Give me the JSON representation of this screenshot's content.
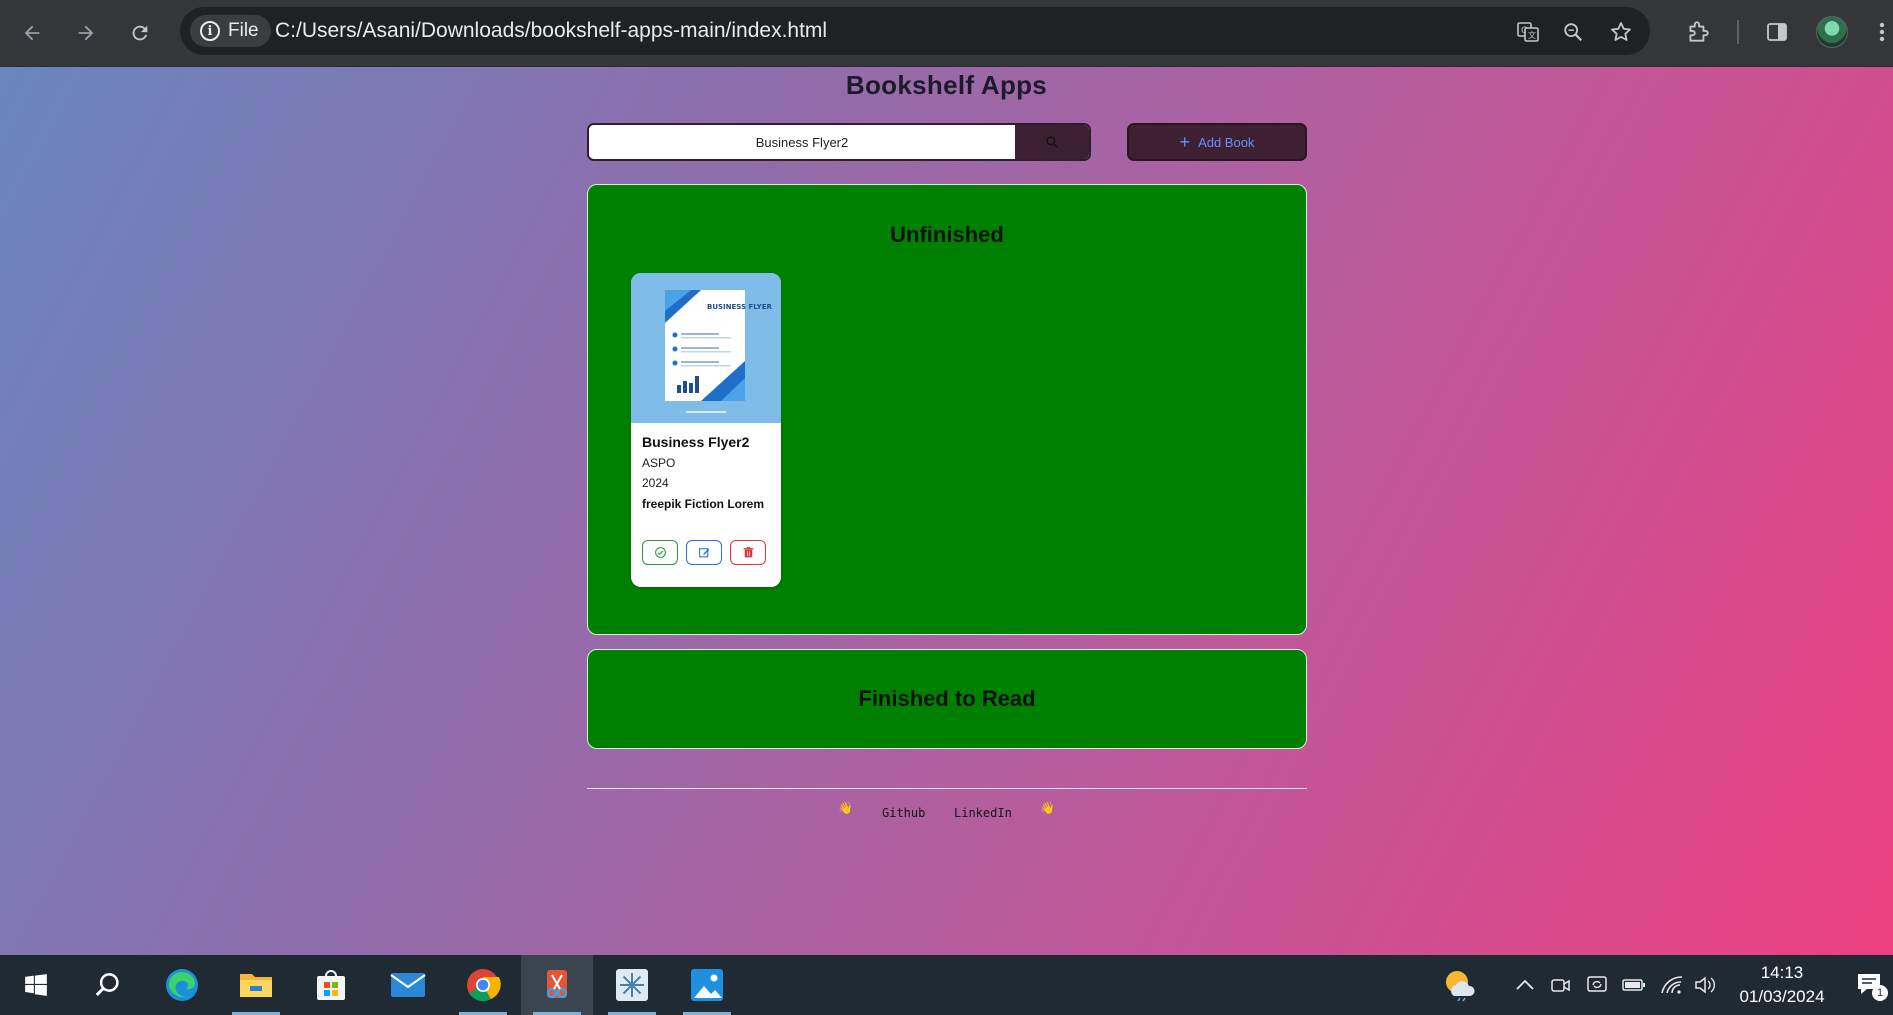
{
  "browser": {
    "scheme_label": "File",
    "url": "C:/Users/Asani/Downloads/bookshelf-apps-main/index.html"
  },
  "app": {
    "title": "Bookshelf Apps",
    "search": {
      "value": "Business Flyer2",
      "placeholder": ""
    },
    "add_label": "Add Book"
  },
  "shelves": {
    "unfinished": {
      "title": "Unfinished",
      "books": [
        {
          "title": "Business Flyer2",
          "author": "ASPO",
          "year": "2024",
          "description": "freepik Fiction Lorem",
          "cover_text": "BUSINESS FLYER"
        }
      ]
    },
    "finished": {
      "title": "Finished to Read",
      "books": []
    }
  },
  "footer": {
    "links": [
      "Github",
      "LinkedIn"
    ]
  },
  "taskbar": {
    "time": "14:13",
    "date": "01/03/2024",
    "notification_count": "1"
  },
  "colors": {
    "shelf_bg": "#008000",
    "button_dark": "#3d2133",
    "add_text": "#6b8cff",
    "done": "#2e9a3a",
    "edit": "#2d6fd6",
    "delete": "#d63b3b"
  }
}
